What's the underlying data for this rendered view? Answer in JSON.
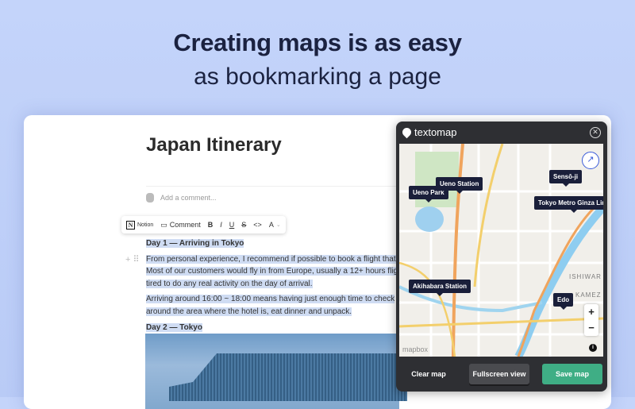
{
  "hero": {
    "line1": "Creating maps is as easy",
    "line2": "as bookmarking a page"
  },
  "doc": {
    "title": "Japan Itinerary",
    "comment_placeholder": "Add a comment...",
    "toolbar": {
      "notion": "Notion",
      "comment": "Comment",
      "bold": "B",
      "italic": "I",
      "underline": "U",
      "strike": "S",
      "code": "<>",
      "color": "A"
    },
    "day1": "Day 1 — Arriving in Tokyo",
    "p1": [
      "From personal experience, I recommend if possible to book a flight that",
      "Most of our customers would fly in from Europe, usually a 12+ hours flig",
      "tired to do any real activity on the day of arrival."
    ],
    "p2": [
      "Arriving around 16:00 ~ 18:00 means having just enough time to check",
      "around the area where the hotel is, eat dinner and unpack."
    ],
    "day2": "Day 2 — Tokyo"
  },
  "panel": {
    "brand": "textomap",
    "markers": [
      "Ueno Park",
      "Ueno Station",
      "Sensō-ji",
      "Tokyo Metro Ginza Line",
      "Akihabara Station",
      "Edo"
    ],
    "map_attribution": "mapbox",
    "district_labels": [
      "ISHIWAR",
      "KAMEZ"
    ],
    "buttons": {
      "clear": "Clear map",
      "fullscreen": "Fullscreen view",
      "save": "Save map"
    },
    "colors": {
      "save": "#3fae85",
      "panel": "#2e2f33",
      "marker": "#1a1f3a"
    }
  }
}
